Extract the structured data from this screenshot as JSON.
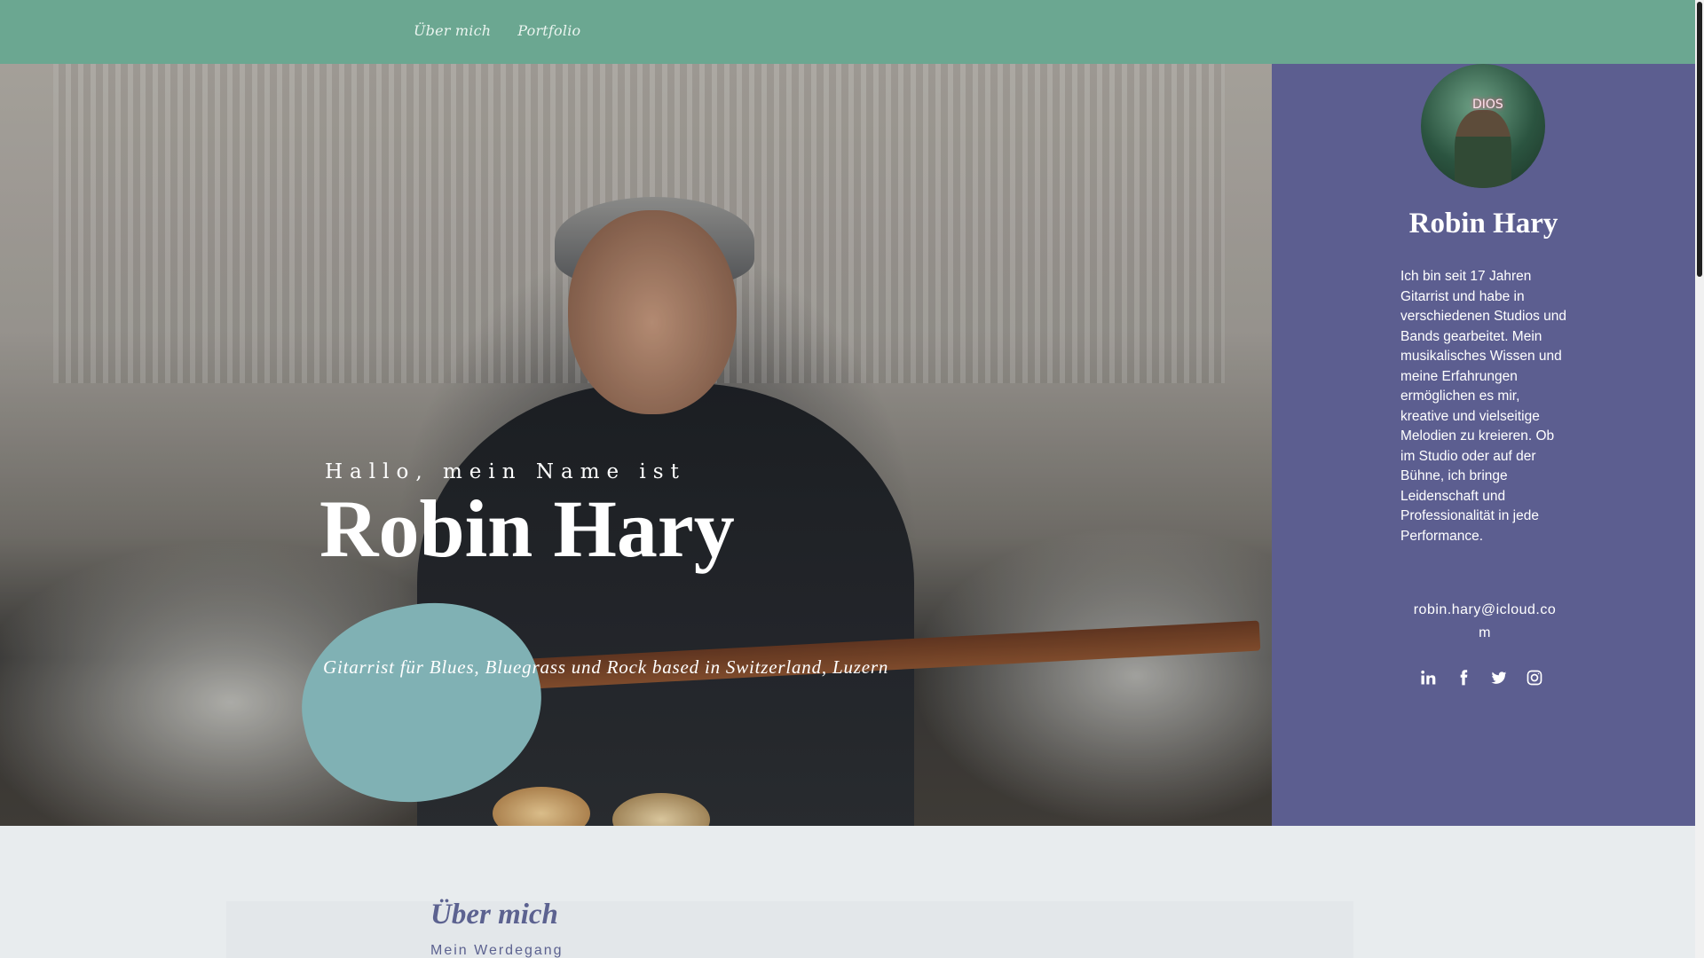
{
  "nav": {
    "items": [
      {
        "label": "Über mich"
      },
      {
        "label": "Portfolio"
      }
    ]
  },
  "hero": {
    "greeting": "Hallo, mein Name ist",
    "name": "Robin Hary",
    "subtitle": "Gitarrist für Blues, Bluegrass und Rock based in Switzerland, Luzern"
  },
  "sidebar": {
    "name": "Robin Hary",
    "bio": "Ich bin seit 17 Jahren Gitarrist und habe in verschiedenen Studios und Bands gearbeitet. Mein musikalisches Wissen und meine Erfahrungen ermöglichen es mir, kreative und vielseitige Melodien zu kreieren. Ob im Studio oder auf der Bühne, ich bringe Leidenschaft und Professionalität in jede Performance.",
    "email": "robin.hary@icloud.com",
    "avatar_neon": "DIOS",
    "socials": [
      {
        "icon": "linkedin-icon"
      },
      {
        "icon": "facebook-icon"
      },
      {
        "icon": "twitter-icon"
      },
      {
        "icon": "instagram-icon"
      }
    ]
  },
  "about": {
    "title": "Über mich",
    "subtitle": "Mein Werdegang"
  },
  "colors": {
    "topbar": "#6ba791",
    "sidebar": "#5c5e90",
    "accent_text": "#5c6290",
    "background": "#e8ecee"
  }
}
